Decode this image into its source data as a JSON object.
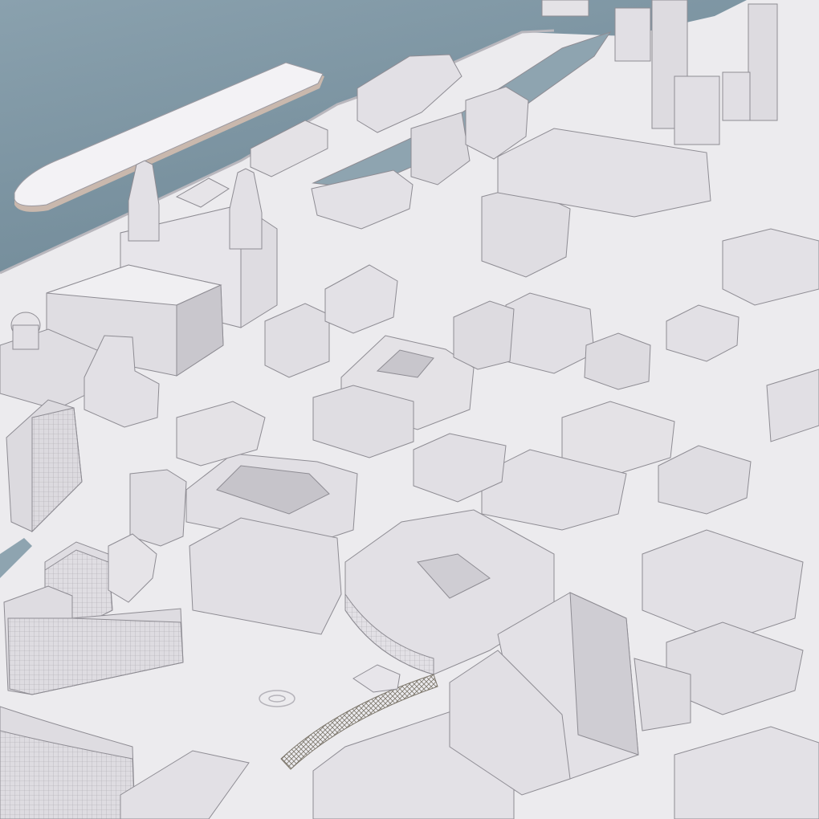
{
  "scene": {
    "kind": "3d-city-massing-render",
    "colors": {
      "water": "#7e97a5",
      "water_deep": "#6d8795",
      "ground": "#ecebee",
      "roof": "#f1f0f3",
      "wall_light": "#dddbe0",
      "wall_shade": "#c2c0c6",
      "line": "#8e8c93",
      "glass_grid": "#b5b3ba",
      "ship_hull": "#c9b8ad",
      "rail_bridge": "#9a9488"
    }
  }
}
